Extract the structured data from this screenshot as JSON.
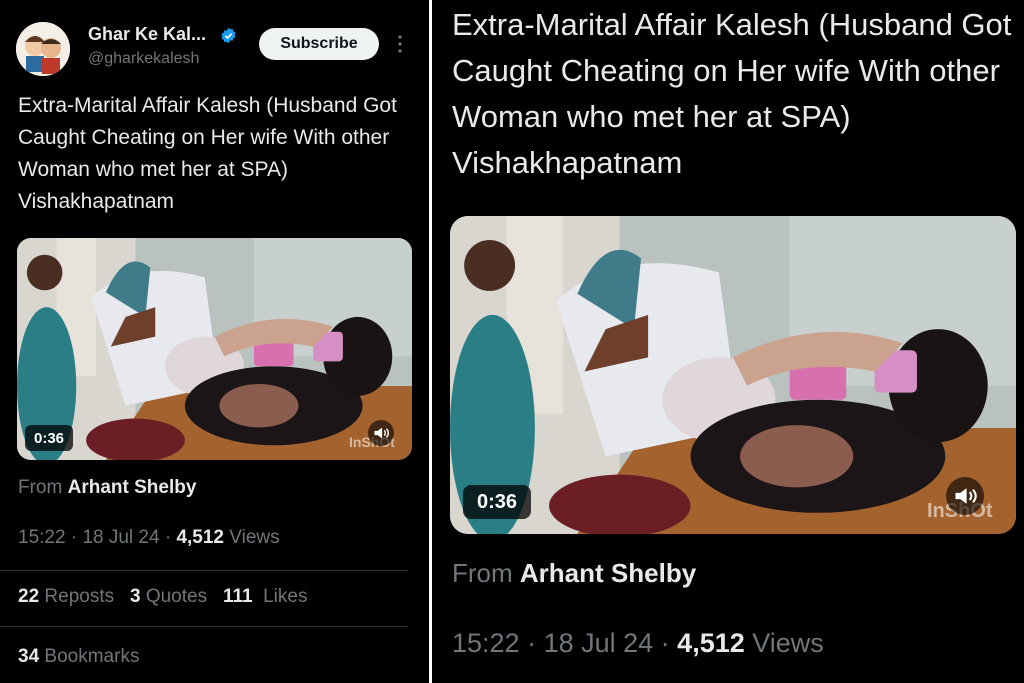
{
  "author": {
    "name": "Ghar Ke Kal...",
    "handle": "@gharkekalesh",
    "verified": true
  },
  "subscribe_label": "Subscribe",
  "tweet_text": "Extra-Marital Affair Kalesh (Husband Got Caught Cheating on Her wife With other Woman who met her at SPA) Vishakhapatnam",
  "video": {
    "duration": "0:36",
    "watermark": "InShOt",
    "mute_icon": "speaker-muted-icon"
  },
  "source": {
    "prefix": "From",
    "name": "Arhant Shelby"
  },
  "meta": {
    "time": "15:22",
    "date": "18 Jul 24",
    "views_count": "4,512",
    "views_label": "Views"
  },
  "stats": {
    "reposts_count": "22",
    "reposts_label": "Reposts",
    "quotes_count": "3",
    "quotes_label": "Quotes",
    "likes_count": "111",
    "likes_label": "Likes",
    "bookmarks_count": "34",
    "bookmarks_label": "Bookmarks"
  },
  "colors": {
    "background": "#000000",
    "text_primary": "#e7e9ea",
    "text_secondary": "#71767b",
    "verified_blue": "#1d9bf0",
    "button_bg": "#eff3f4"
  }
}
